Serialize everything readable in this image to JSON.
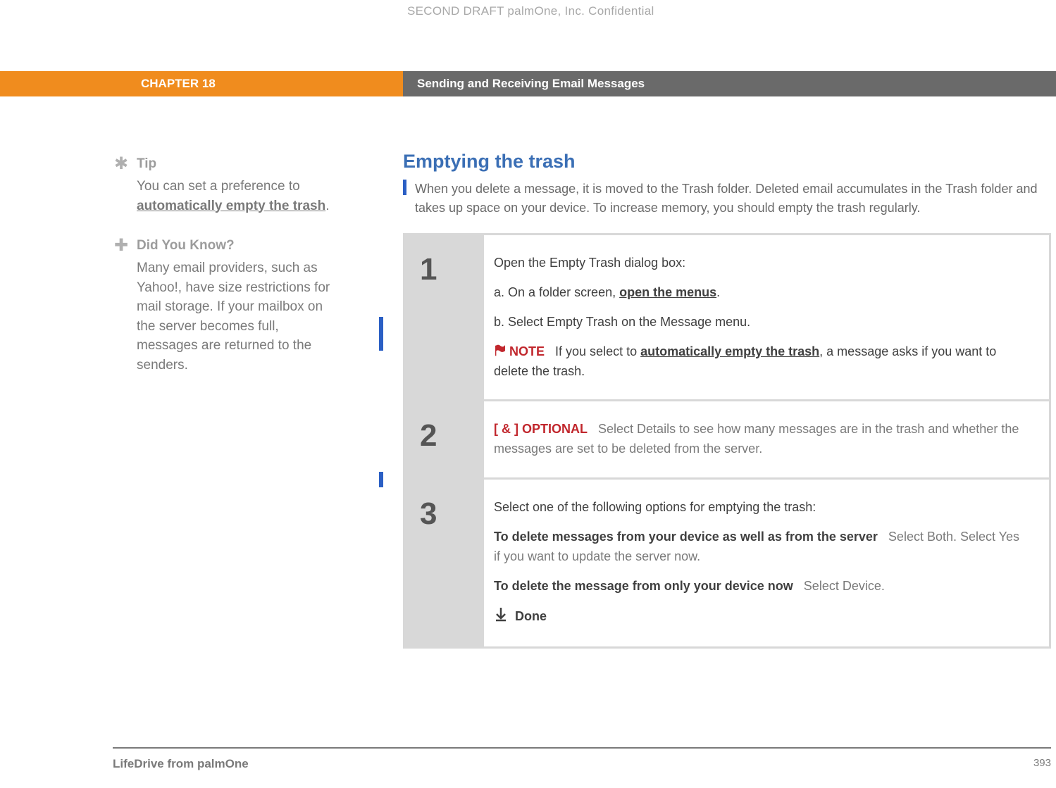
{
  "watermark": "SECOND DRAFT palmOne, Inc.  Confidential",
  "chapter": {
    "label": "CHAPTER 18",
    "title": "Sending and Receiving Email Messages"
  },
  "sidebar": {
    "tip": {
      "label": "Tip",
      "pre": "You can set a preference to ",
      "link": "automatically empty the trash",
      "post": "."
    },
    "dyk": {
      "label": "Did You Know?",
      "body": "Many email providers, such as Yahoo!, have size restrictions for mail storage. If your mailbox on the server becomes full, messages are returned to the senders."
    }
  },
  "main": {
    "title": "Emptying the trash",
    "intro": "When you delete a message, it is moved to the Trash folder. Deleted email accumulates in the Trash folder and takes up space on your device. To increase memory, you should empty the trash regularly.",
    "steps": [
      {
        "num": "1",
        "lead": "Open the Empty Trash dialog box:",
        "a_pre": "a.  On a folder screen, ",
        "a_link": "open the menus",
        "a_post": ".",
        "b": "b.  Select Empty Trash on the Message menu.",
        "note_label": "NOTE",
        "note_pre": "If you select to ",
        "note_link": "automatically empty the trash",
        "note_post": ", a message asks if you want to delete the trash."
      },
      {
        "num": "2",
        "opt_tag": "[ & ]  OPTIONAL",
        "opt_text": "Select Details to see how many messages are in the trash and whether the messages are set to be deleted from the server."
      },
      {
        "num": "3",
        "lead": "Select one of the following options for emptying the trash:",
        "opt1_bold": "To delete messages from your device as well as from the server",
        "opt1_rest": "Select Both. Select Yes if you want to update the server now.",
        "opt2_bold": "To delete the message from only your device now",
        "opt2_rest": "Select Device.",
        "done": "Done"
      }
    ]
  },
  "footer": {
    "product": "LifeDrive from palmOne",
    "page": "393"
  }
}
